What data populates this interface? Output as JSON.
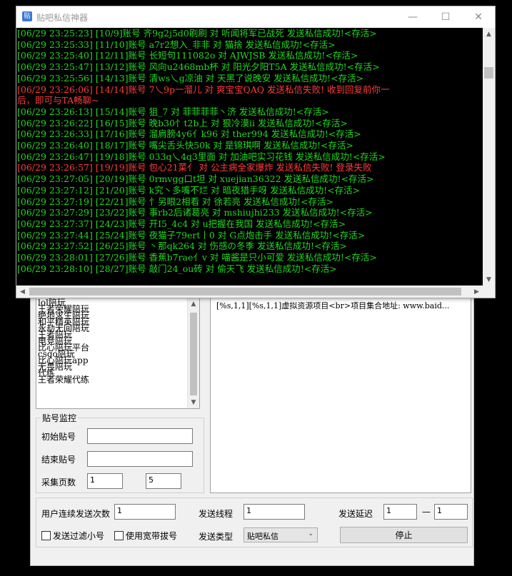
{
  "window": {
    "title": "贴吧私信神器",
    "app_icon": "app-icon-bar",
    "minimize_glyph": "—",
    "maximize_glyph": "☐",
    "close_glyph": "✕"
  },
  "log_lines": [
    {
      "text": "[06/29 23:25:23]  [10/9]账号 齐9g2j5d0刷刷 对 听闻将军已战死 发送私信成功!<存活>",
      "status": "ok"
    },
    {
      "text": "[06/29 23:25:33]  [11/10]账号 a7r2想入_非非 对 猫捨 发送私信成功!<存活>",
      "status": "ok"
    },
    {
      "text": "[06/29 23:25:40]  [12/11]账号 长短句111082o 对 AJWJSB 发送私信成功!<存活>",
      "status": "ok"
    },
    {
      "text": "[06/29 23:25:47]  [13/12]账号 风向u2468mb杯 对 阳光夕阳T5A 发送私信成功!<存活>",
      "status": "ok"
    },
    {
      "text": "[06/29 23:25:56]  [14/13]账号 清ws乀g凉油 对 天黑了说晚安 发送私信成功!<存活>",
      "status": "ok"
    },
    {
      "text": "[06/29 23:26:06]  [14/14]账号 7乀9p一溜儿 对 爽宝宝QAQ 发送私信失败! 收到回复前你一",
      "status": "fail"
    },
    {
      "text": "后，即可与TA畅聊~",
      "status": "fail"
    },
    {
      "text": "[06/29 23:26:13]  [15/14]账号 狙_7 对 菲菲菲菲丶济 发送私信成功!<存活>",
      "status": "ok"
    },
    {
      "text": "[06/29 23:26:22]  [16/15]账号 晚b30忄t2b上 对 狠冷漠ii 发送私信成功!<存活>",
      "status": "ok"
    },
    {
      "text": "[06/29 23:26:33]  [17/16]账号 溜肩膀4y6亻k96 对 ther994 发送私信成功!<存活>",
      "status": "ok"
    },
    {
      "text": "[06/29 23:26:40]  [18/17]账号 嘴尖舌头快50k 对 是锦琪啊 发送私信成功!<存活>",
      "status": "ok"
    },
    {
      "text": "[06/29 23:26:47]  [19/18]账号 033q乀4q3里面 对 加油吧实习花钱 发送私信成功!<存活>",
      "status": "ok"
    },
    {
      "text": "[06/29 23:26:57]  [19/19]账号 包心21菜亻 对 公主病全家爆炸 发送私信失败! 登录失败",
      "status": "fail"
    },
    {
      "text": "[06/29 23:27:05]  [20/19]账号 0rmvgg口t坦 对 xuejian36322 发送私信成功!<存活>",
      "status": "ok"
    },
    {
      "text": "[06/29 23:27:12]  [21/20]账号 k究丶多嘴不烂 对 暗夜猎手呀 发送私信成功!<存活>",
      "status": "ok"
    },
    {
      "text": "[06/29 23:27:19]  [22/21]账号 忄另眼2相看 对 徐若亮 发送私信成功!<存活>",
      "status": "ok"
    },
    {
      "text": "[06/29 23:27:29]  [23/22]账号 事rb2后诸葛亮 对 mshiujhi233 发送私信成功!<存活>",
      "status": "ok"
    },
    {
      "text": "[06/29 23:27:37]  [24/23]账号 开I5_4c4 对 u把握在我国 发送私信成功!<存活>",
      "status": "ok"
    },
    {
      "text": "[06/29 23:27:44]  [25/24]账号 夜猫子79ert丨0 对 G点炮击手 发送私信成功!<存活>",
      "status": "ok"
    },
    {
      "text": "[06/29 23:27:52]  [26/25]账号 丶那qk264 对 伤感の冬季 发送私信成功!<存活>",
      "status": "ok"
    },
    {
      "text": "[06/29 23:28:01]  [27/26]账号 香蕉b7rae亻v 对 喵酱是只小可爱 发送私信成功!<存活>",
      "status": "ok"
    },
    {
      "text": "[06/29 23:28:10]  [28/27]账号 敲门24_ou砖 对 偷天飞 发送私信成功!<存活>",
      "status": "ok"
    }
  ],
  "bar_list": [
    "lol陪玩",
    "王者荣耀陪玩",
    "绝地求生陪玩",
    "和平精英陪玩",
    "永劫无间陪玩",
    "王者陪玩",
    "电竞陪玩",
    "比心陪玩平台",
    "csgo陪玩",
    "比心陪玩app",
    "无畏陪玩",
    "代练",
    "王者荣耀代练"
  ],
  "info_text": "[%s,1,1][%s,1,1]虚拟资源项目<br>项目集合地址: www.baid...",
  "monitor": {
    "title": "贴号监控",
    "start_label": "初始贴号",
    "start_value": "",
    "end_label": "结束贴号",
    "end_value": "",
    "pages_label": "采集页数",
    "pages_from": "1",
    "pages_to": "5"
  },
  "controls": {
    "consecutive_label": "用户连续发送次数",
    "consecutive_value": "1",
    "threads_label": "发送线程",
    "threads_value": "1",
    "delay_label": "发送延迟",
    "delay_from": "1",
    "delay_sep": "—",
    "delay_to": "1",
    "filter_label": "发送过滤小号",
    "filter_checked": false,
    "broadband_label": "使用宽带拔号",
    "broadband_checked": false,
    "send_type_label": "发送类型",
    "send_type_value": "贴吧私信",
    "stop_label": "停止"
  },
  "colors": {
    "success": "#22d822",
    "failure": "#ff3b3b",
    "log_background": "#000000"
  }
}
